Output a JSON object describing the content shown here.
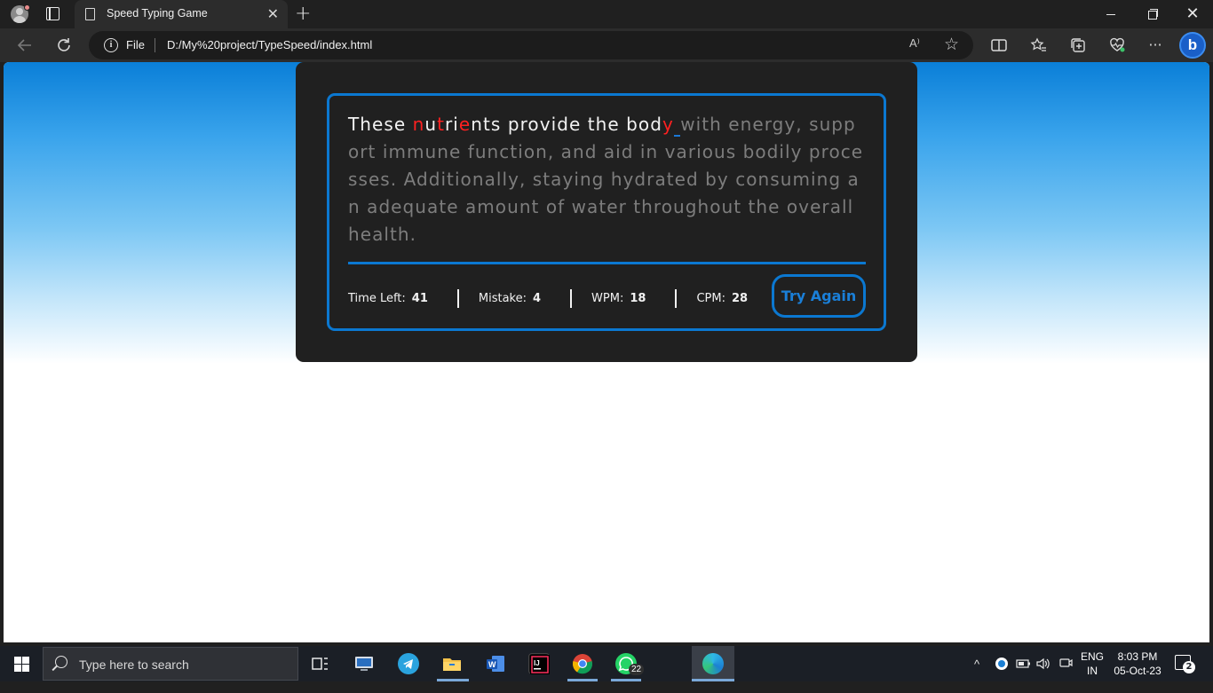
{
  "browser": {
    "tab_title": "Speed Typing Game",
    "tab_close": "✕",
    "new_tab": "+",
    "window_close": "✕",
    "address": {
      "protocol_label": "File",
      "url": "D:/My%20project/TypeSpeed/index.html",
      "read_aloud": "A⁾"
    }
  },
  "game": {
    "typed_chars": [
      {
        "ch": "T",
        "state": "ok"
      },
      {
        "ch": "h",
        "state": "ok"
      },
      {
        "ch": "e",
        "state": "ok"
      },
      {
        "ch": "s",
        "state": "ok"
      },
      {
        "ch": "e",
        "state": "ok"
      },
      {
        "ch": " ",
        "state": "ok"
      },
      {
        "ch": "n",
        "state": "bad"
      },
      {
        "ch": "u",
        "state": "ok"
      },
      {
        "ch": "t",
        "state": "bad"
      },
      {
        "ch": "r",
        "state": "ok"
      },
      {
        "ch": "i",
        "state": "ok"
      },
      {
        "ch": "e",
        "state": "bad"
      },
      {
        "ch": "n",
        "state": "ok"
      },
      {
        "ch": "t",
        "state": "ok"
      },
      {
        "ch": "s",
        "state": "ok"
      },
      {
        "ch": " ",
        "state": "ok"
      },
      {
        "ch": "p",
        "state": "ok"
      },
      {
        "ch": "r",
        "state": "ok"
      },
      {
        "ch": "o",
        "state": "ok"
      },
      {
        "ch": "v",
        "state": "ok"
      },
      {
        "ch": "i",
        "state": "ok"
      },
      {
        "ch": "d",
        "state": "ok"
      },
      {
        "ch": "e",
        "state": "ok"
      },
      {
        "ch": " ",
        "state": "ok"
      },
      {
        "ch": "t",
        "state": "ok"
      },
      {
        "ch": "h",
        "state": "ok"
      },
      {
        "ch": "e",
        "state": "ok"
      },
      {
        "ch": " ",
        "state": "ok"
      },
      {
        "ch": "b",
        "state": "ok"
      },
      {
        "ch": "o",
        "state": "ok"
      },
      {
        "ch": "d",
        "state": "ok"
      },
      {
        "ch": "y",
        "state": "bad"
      }
    ],
    "cursor_char": " ",
    "remaining_text": "with energy, support immune function, and aid in various bodily processes. Additionally, staying hydrated by consuming an adequate amount of water throughout the overall health.",
    "stats": {
      "time_left_label": "Time Left:",
      "time_left": "41",
      "mistake_label": "Mistake:",
      "mistake": "4",
      "wpm_label": "WPM:",
      "wpm": "18",
      "cpm_label": "CPM:",
      "cpm": "28"
    },
    "try_again_label": "Try Again"
  },
  "taskbar": {
    "search_placeholder": "Type here to search",
    "whatsapp_badge": "22",
    "lang_top": "ENG",
    "lang_bottom": "IN",
    "time": "8:03 PM",
    "date": "05-Oct-23",
    "notifications": "2"
  },
  "colors": {
    "accent": "#0b78d1",
    "card_bg": "#202020",
    "correct_text": "#f2f2f2",
    "incorrect_text": "#ff2020",
    "pending_text": "#7d7d7d"
  }
}
